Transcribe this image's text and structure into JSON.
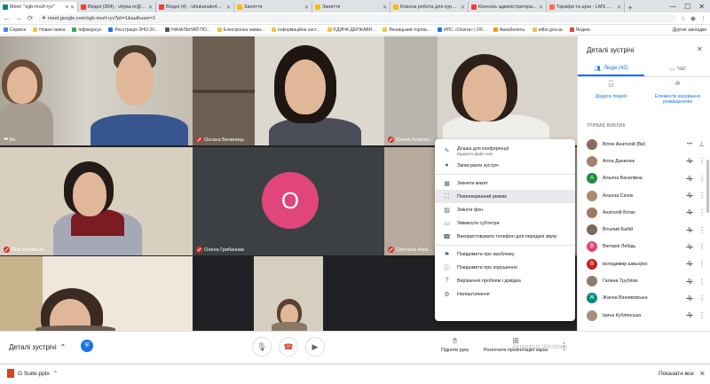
{
  "browser": {
    "tabs": [
      {
        "title": "Meet: \"xgb-mvzf-ryv\"",
        "color": "#00897b",
        "active": true,
        "rec": true
      },
      {
        "title": "Вхідні (304) - vityka.m@gm",
        "color": "#ea4335"
      },
      {
        "title": "Вхідні (4) - vitiukanato4@...",
        "color": "#ea4335"
      },
      {
        "title": "Заняття",
        "color": "#fbbc04"
      },
      {
        "title": "Заняття",
        "color": "#fbbc04"
      },
      {
        "title": "Класна робота для курсу...",
        "color": "#fbbc04"
      },
      {
        "title": "Консоль адміністратора...",
        "color": "#ea4335"
      },
      {
        "title": "Тарифи та ціни - LMS Col...",
        "color": "#ff7043"
      }
    ],
    "url": "meet.google.com/xgb-mvzf-ryv?pli=1&authuser=1",
    "bookmarks": [
      {
        "label": "Сервіси",
        "color": "#4285f4"
      },
      {
        "label": "Новая папка",
        "color": "#f6c343"
      },
      {
        "label": "Інфокурсус",
        "color": "#34a853"
      },
      {
        "label": "Реєстрація ЗНО-20...",
        "color": "#1a73e8"
      },
      {
        "label": "НАЧАЛЬНИЙ ПО...",
        "color": "#555555"
      },
      {
        "label": "Електронна заява...",
        "color": "#f6c343"
      },
      {
        "label": "Інформаційна сист...",
        "color": "#f6c343"
      },
      {
        "label": "ЄДИНА ДЕРЖАВН...",
        "color": "#f6c343"
      },
      {
        "label": "Вінницький торгов...",
        "color": "#f6c343"
      },
      {
        "label": "ИПС «Освіта» | Об...",
        "color": "#1a73e8"
      },
      {
        "label": "Авиабилеты",
        "color": "#ff9800"
      },
      {
        "label": "edbo.gov.ua",
        "color": "#f6c343"
      },
      {
        "label": "Яндекс",
        "color": "#ea4335"
      }
    ],
    "other_bookmarks": "Другие закладки"
  },
  "tiles": {
    "you": "Ви",
    "t2": "",
    "t3": "Оксана Велинець",
    "t4": "Олена Анатолі...",
    "t5": "Яна Бугайська",
    "t6": "Олена Грибанова",
    "t6_initial": "O",
    "t7": "Світлана Фіюк..."
  },
  "menu": {
    "items": [
      {
        "icon": "✎",
        "label": "Дошка для конференції",
        "sub": "Відкрити файл Jam",
        "name": "whiteboard"
      },
      {
        "icon": "●",
        "label": "Записувати зустріч",
        "name": "record"
      },
      {
        "sep": true
      },
      {
        "icon": "▦",
        "label": "Змінити макет",
        "name": "change-layout"
      },
      {
        "icon": "⛶",
        "label": "Повноекранний режим",
        "name": "fullscreen",
        "hl": true
      },
      {
        "icon": "▨",
        "label": "Змініти фон",
        "name": "change-background"
      },
      {
        "icon": "▭",
        "label": "Увімкнути субтитри",
        "name": "captions"
      },
      {
        "icon": "☎",
        "label": "Використовувати телефон для передачі звуку",
        "name": "phone-audio"
      },
      {
        "sep": true
      },
      {
        "icon": "⚑",
        "label": "Повідомити про проблему",
        "name": "report-problem"
      },
      {
        "icon": "ⓘ",
        "label": "Повідомити про порушення",
        "name": "report-abuse"
      },
      {
        "icon": "?",
        "label": "Вирішення проблем і довідка",
        "name": "help"
      },
      {
        "icon": "⚙",
        "label": "Налаштування",
        "name": "settings"
      }
    ]
  },
  "bottom": {
    "meeting_details": "Деталі зустрічі",
    "raise_hand": "Підняти руку",
    "present": "Розпочати презентацію зараз",
    "watermark_1": "Активація Windows",
    "watermark_2": "Чтобы активировать Windows, перейдите в раздел \"Параметры\"."
  },
  "downloads": {
    "file": "G Suite.pptx",
    "show_all": "Показати все"
  },
  "panel": {
    "title": "Деталі зустрічі",
    "tab_people": "Люди (42)",
    "tab_chat": "Чат",
    "add_people": "Додати людей",
    "host_controls": "Елементи керування розміщенням",
    "section": "ТРИВАЄ ВИКЛИК",
    "people": [
      {
        "name": "Вітюк Анатолій (Ви)",
        "initial": "",
        "color": "#8a6d5a",
        "me": true
      },
      {
        "name": "Алла Данилюк",
        "initial": "",
        "color": "#a0826d"
      },
      {
        "name": "Альона Василівна",
        "initial": "A",
        "color": "#1e8e3e"
      },
      {
        "name": "Альона Сачок",
        "initial": "",
        "color": "#b08a70"
      },
      {
        "name": "Анатолій Вітюк",
        "initial": "",
        "color": "#9c7a66"
      },
      {
        "name": "Віталий Бабій",
        "initial": "",
        "color": "#7a6a5e"
      },
      {
        "name": "Вікторія Лебідь",
        "initial": "B",
        "color": "#e0457b"
      },
      {
        "name": "володимир шмьорко",
        "initial": "B",
        "color": "#c5221f"
      },
      {
        "name": "Галина Трублюк",
        "initial": "",
        "color": "#8d7b6c"
      },
      {
        "name": "Жанна Вінниковська",
        "initial": "Ж",
        "color": "#00897b"
      },
      {
        "name": "Ірина Кублинська",
        "initial": "",
        "color": "#a98d7b"
      }
    ]
  },
  "colors": {
    "accent": "#1a73e8",
    "stage_bg": "#202124",
    "avatar_o": "#e0457b"
  }
}
